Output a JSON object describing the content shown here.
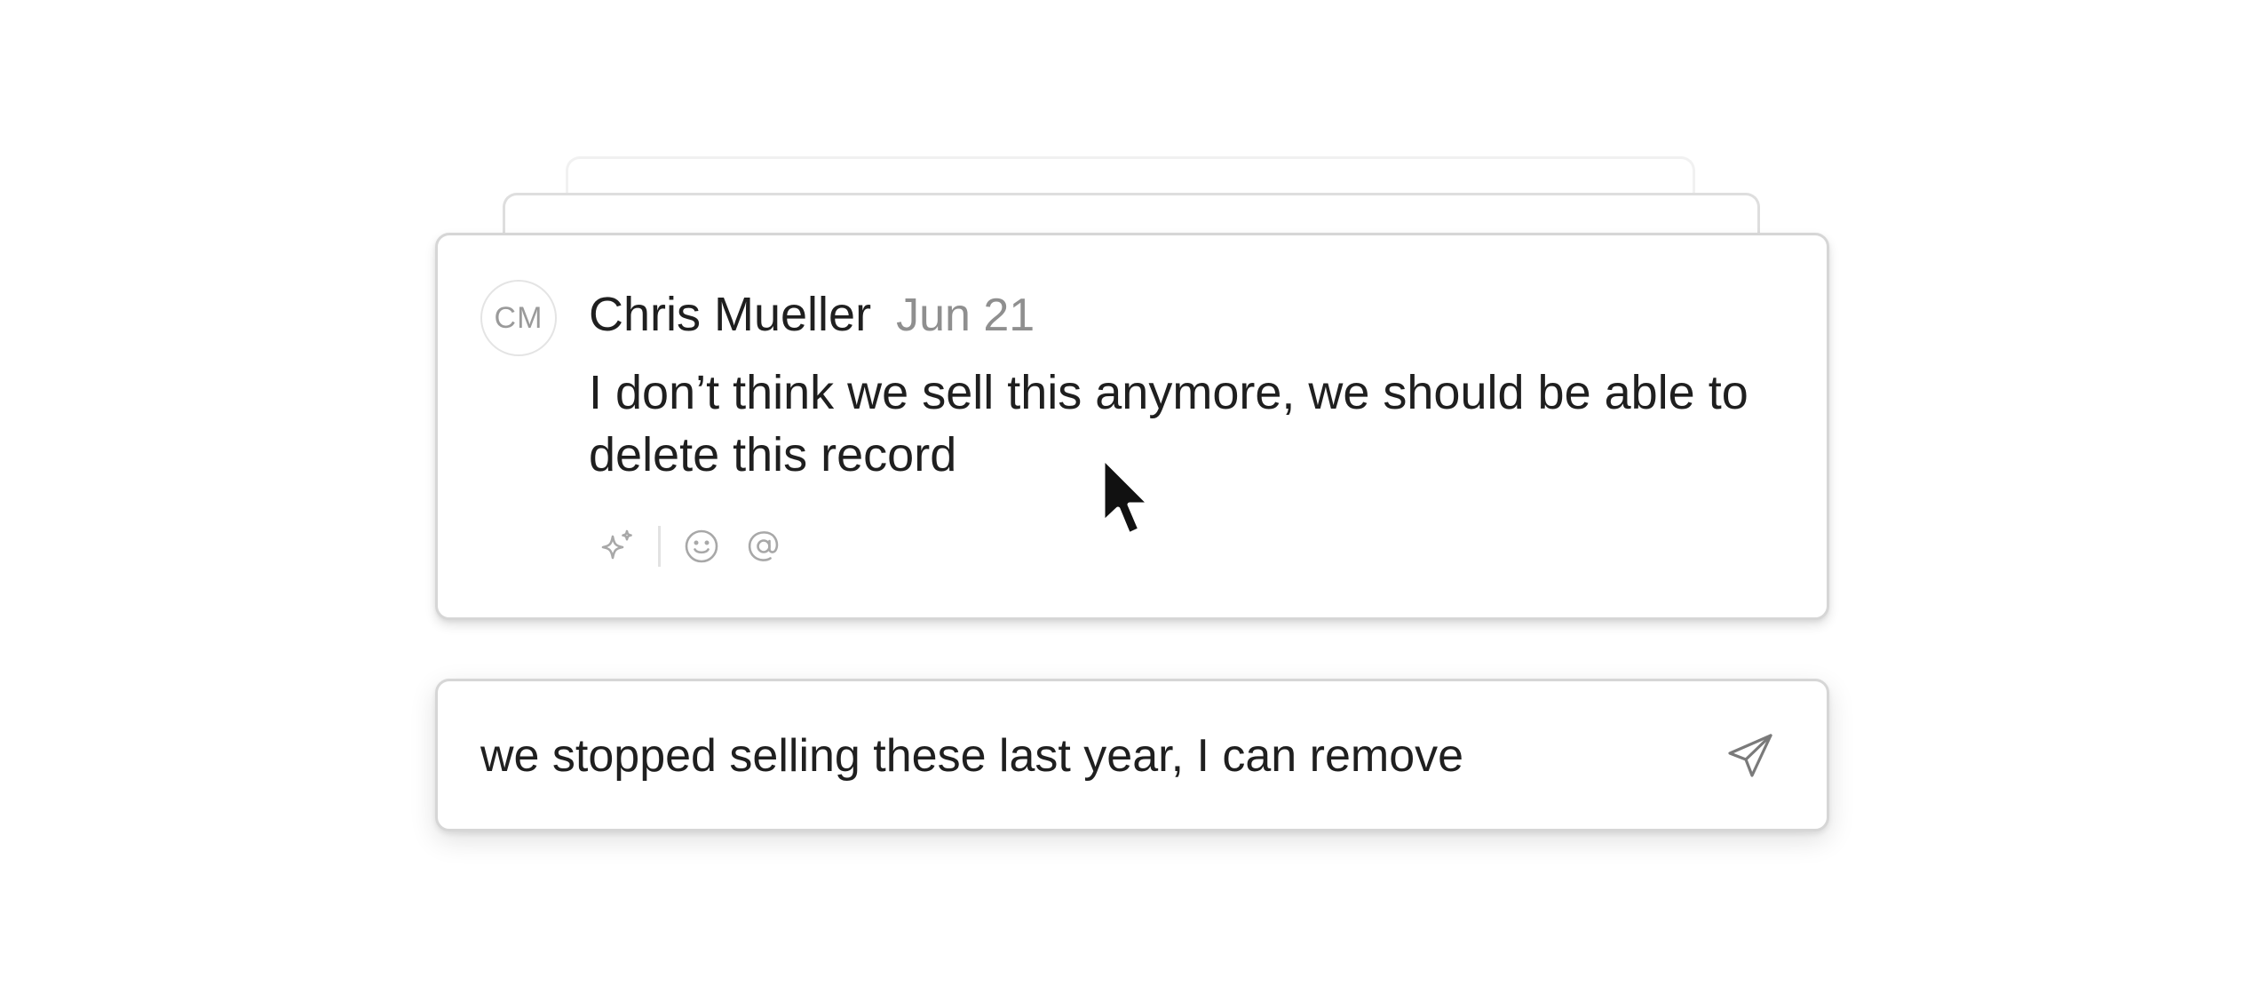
{
  "comment": {
    "avatar_initials": "CM",
    "author": "Chris Mueller",
    "date": "Jun 21",
    "body": "I don’t think we sell this anymore, we should be able to delete this record",
    "actions": {
      "ai_icon": "sparkle-icon",
      "emoji_icon": "smiley-icon",
      "mention_icon": "at-sign-icon"
    }
  },
  "reply": {
    "value": "we stopped selling these last year, I can remove",
    "send_icon": "paper-plane-icon"
  },
  "colors": {
    "text_primary": "#1f1f1f",
    "text_muted": "#8f8f8f",
    "icon_muted": "#a8a8a8",
    "border": "#d6d6d6"
  }
}
